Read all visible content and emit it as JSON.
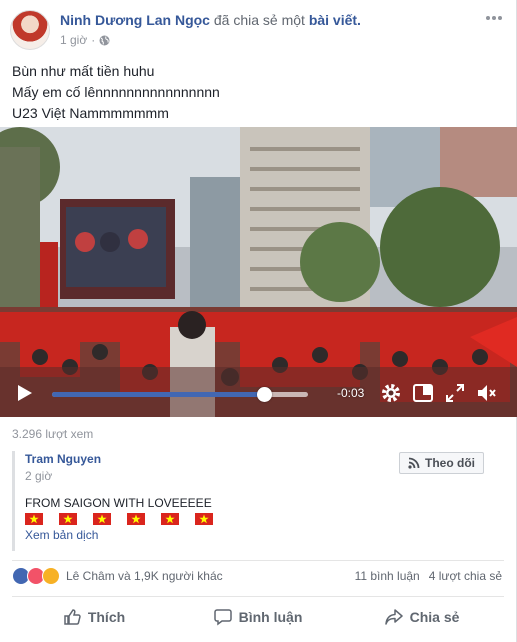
{
  "post": {
    "author": "Ninh Dương Lan Ngọc",
    "action_text": "đã chia sẻ một",
    "action_link": "bài viết.",
    "time": "1 giờ",
    "privacy_icon": "globe-icon",
    "menu_icon": "more-options-icon",
    "lines": [
      "Bùn như mất tiền huhu",
      "Mấy em cố lênnnnnnnnnnnnnnnn",
      "U23 Việt Nammmmmmm"
    ]
  },
  "video": {
    "time_remaining": "-0:03",
    "progress": 0.83,
    "controls": [
      "play-icon",
      "settings-icon",
      "pip-icon",
      "fullscreen-icon",
      "mute-icon"
    ]
  },
  "views": "3.296 lượt xem",
  "comment": {
    "author": "Tram Nguyen",
    "time": "2 giờ",
    "follow_label": "Theo dõi",
    "text": "FROM SAIGON WITH LOVEEEEE",
    "flag_count": 6,
    "translate_label": "Xem bản dịch"
  },
  "reactions": {
    "types": [
      "like",
      "love",
      "sad"
    ],
    "summary": "Lê Châm và 1,9K người khác",
    "comments": "11 bình luận",
    "shares": "4 lượt chia sẻ"
  },
  "actions": {
    "like": "Thích",
    "comment": "Bình luận",
    "share": "Chia sẻ"
  },
  "colors": {
    "link": "#365899",
    "accent": "#4267b2",
    "flag_red": "#da251d",
    "flag_star": "#ffff00"
  }
}
